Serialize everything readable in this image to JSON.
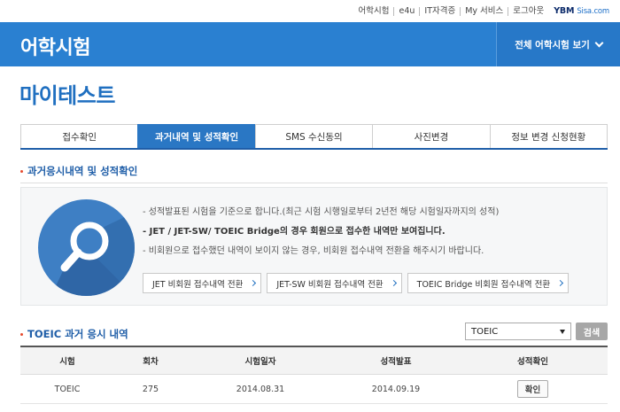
{
  "topbar": {
    "links": [
      "어학시험",
      "e4u",
      "IT자격증",
      "My 서비스",
      "로그아웃"
    ],
    "logo_main": "YBM",
    "logo_sub": "Sisa.com"
  },
  "header": {
    "title": "어학시험",
    "all_exams_label": "전체 어학시험 보기"
  },
  "page_title": "마이테스트",
  "tabs": [
    {
      "label": "접수확인",
      "active": false
    },
    {
      "label": "과거내역 및 성적확인",
      "active": true
    },
    {
      "label": "SMS 수신동의",
      "active": false
    },
    {
      "label": "사진변경",
      "active": false
    },
    {
      "label": "정보 변경 신청현황",
      "active": false
    }
  ],
  "section1_title": "과거응시내역 및 성적확인",
  "info": {
    "notes": [
      "- 성적발표된 시험을 기준으로 합니다.(최근 시험 시행일로부터 2년전 해당 시험일자까지의 성적)",
      "- JET / JET-SW/ TOEIC Bridge의 경우 회원으로 접수한 내역만 보여집니다.",
      "- 비회원으로 접수했던 내역이 보이지 않는 경우, 비회원 접수내역 전환을 해주시기 바랍니다."
    ],
    "buttons": [
      "JET 비회원 접수내역 전환",
      "JET-SW 비회원 접수내역 전환",
      "TOEIC Bridge 비회원 접수내역 전환"
    ]
  },
  "section2_title": "TOEIC 과거 응시 내역",
  "search": {
    "selected": "TOEIC",
    "button": "검색"
  },
  "table": {
    "headers": [
      "시험",
      "회차",
      "시험일자",
      "성적발표",
      "성적확인"
    ],
    "rows": [
      {
        "exam": "TOEIC",
        "round": "275",
        "date": "2014.08.31",
        "release": "2014.09.19",
        "action": "확인"
      }
    ]
  },
  "colors": {
    "brand_blue": "#2a80d1",
    "active_tab": "#2a77c4",
    "accent_dot": "#e64a2e"
  }
}
